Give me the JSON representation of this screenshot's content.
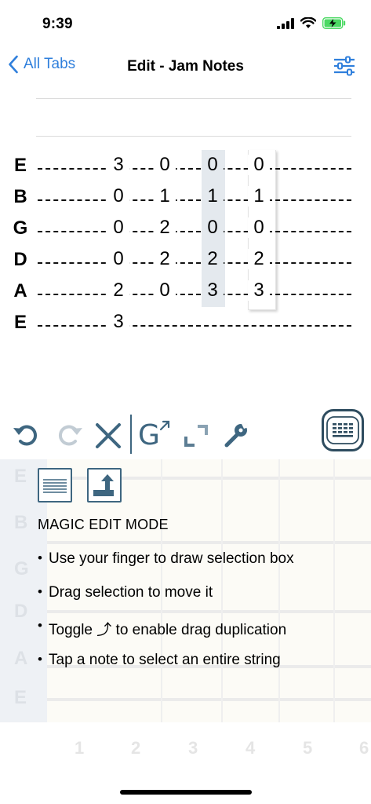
{
  "status": {
    "time": "9:39"
  },
  "nav": {
    "back_label": "All Tabs",
    "title": "Edit - Jam Notes"
  },
  "tab": {
    "strings": [
      {
        "name": "E",
        "notes": [
          "3",
          "0",
          "0",
          "0"
        ]
      },
      {
        "name": "B",
        "notes": [
          "0",
          "1",
          "1",
          "1"
        ]
      },
      {
        "name": "G",
        "notes": [
          "0",
          "2",
          "0",
          "0"
        ]
      },
      {
        "name": "D",
        "notes": [
          "0",
          "2",
          "2",
          "2"
        ]
      },
      {
        "name": "A",
        "notes": [
          "2",
          "0",
          "3",
          "3"
        ]
      },
      {
        "name": "E",
        "notes": [
          "3",
          "",
          "",
          ""
        ]
      }
    ]
  },
  "toolbar": {
    "icons": [
      "undo-icon",
      "redo-icon",
      "delete-icon",
      "chord-glyph-icon",
      "expand-icon",
      "wrench-icon",
      "keyboard-icon"
    ],
    "chord_glyph_label": "G"
  },
  "panel": {
    "background_strings": [
      "E",
      "B",
      "G",
      "D",
      "A",
      "E"
    ],
    "mode_title": "MAGIC EDIT MODE",
    "bullets": [
      "Use your finger to draw selection box",
      "Drag selection to move it",
      "Toggle ⤴ to enable drag duplication",
      "Tap a note to select an entire string"
    ]
  },
  "fret_numbers": [
    "1",
    "2",
    "3",
    "4",
    "5",
    "6"
  ],
  "colors": {
    "accent": "#2f7fdc",
    "toolbar_icon": "#3e6680",
    "highlight": "#e4e9ee",
    "battery": "#4cd964"
  }
}
